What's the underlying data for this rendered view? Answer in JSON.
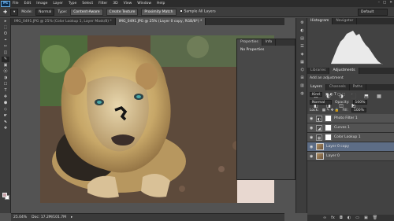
{
  "app": {
    "logo": "Ps"
  },
  "menu": [
    "File",
    "Edit",
    "Image",
    "Layer",
    "Type",
    "Select",
    "Filter",
    "3D",
    "View",
    "Window",
    "Help"
  ],
  "window_controls": [
    "–",
    "□",
    "✕"
  ],
  "options": {
    "mode_label": "Mode:",
    "mode_value": "Normal",
    "type_label": "Type:",
    "content_aware": "Content-Aware",
    "create_texture": "Create Texture",
    "proximity_match": "Proximity Match",
    "sample_all_layers": "Sample All Layers",
    "workspace": "Default"
  },
  "tabs": [
    "IMG_0491.JPG @ 25% (Color Lookup 1, Layer Mask/8) *",
    "IMG_0491.JPG @ 25% (Layer 0 copy, RGB/8*) *"
  ],
  "tools": [
    "▸",
    "⬚",
    "ʘ",
    "⌖",
    "✂",
    "◫",
    "✎",
    "▣",
    "⦿",
    "◑",
    "☐",
    "T",
    "✥",
    "⬢",
    "◇",
    "☛",
    "⬉",
    "✚"
  ],
  "status": {
    "zoom": "25.04%",
    "doc": "Doc: 17.2M/101.7M"
  },
  "properties": {
    "tabs": [
      "Properties",
      "Info"
    ],
    "title": "No Properties"
  },
  "strip_icons": [
    "⚙",
    "◐",
    "▤",
    "☰",
    "◈",
    "▦",
    "⌬",
    "⊞",
    "▥",
    "◍"
  ],
  "top_panel": {
    "tabs": [
      "Histogram",
      "Navigator"
    ]
  },
  "adjust_panel": {
    "tabs": [
      "Libraries",
      "Adjustments"
    ],
    "head": "Add an adjustment",
    "icons": [
      "☼",
      "▥",
      "◪",
      "◩",
      "▽",
      "◎",
      "⚖",
      "◐",
      "◑",
      "⬛",
      "⬒",
      "▦",
      "◧",
      "◨",
      "◫",
      "◩",
      "◪",
      "▤"
    ]
  },
  "layers_panel": {
    "tabs": [
      "Layers",
      "Channels",
      "Paths"
    ],
    "kind": "Kind",
    "blend": "Normal",
    "opacity_label": "Opacity:",
    "opacity": "100%",
    "lock_label": "Lock:",
    "fill_label": "Fill:",
    "fill": "100%",
    "layers": [
      {
        "name": "Photo Filter 1",
        "type": "adj",
        "glyph": "◐"
      },
      {
        "name": "Curves 1",
        "type": "adj",
        "glyph": "◪"
      },
      {
        "name": "Color Lookup 1",
        "type": "adj",
        "glyph": "▦"
      },
      {
        "name": "Layer 0 copy",
        "type": "pixel",
        "selected": true
      },
      {
        "name": "Layer 0",
        "type": "pixel"
      }
    ]
  }
}
